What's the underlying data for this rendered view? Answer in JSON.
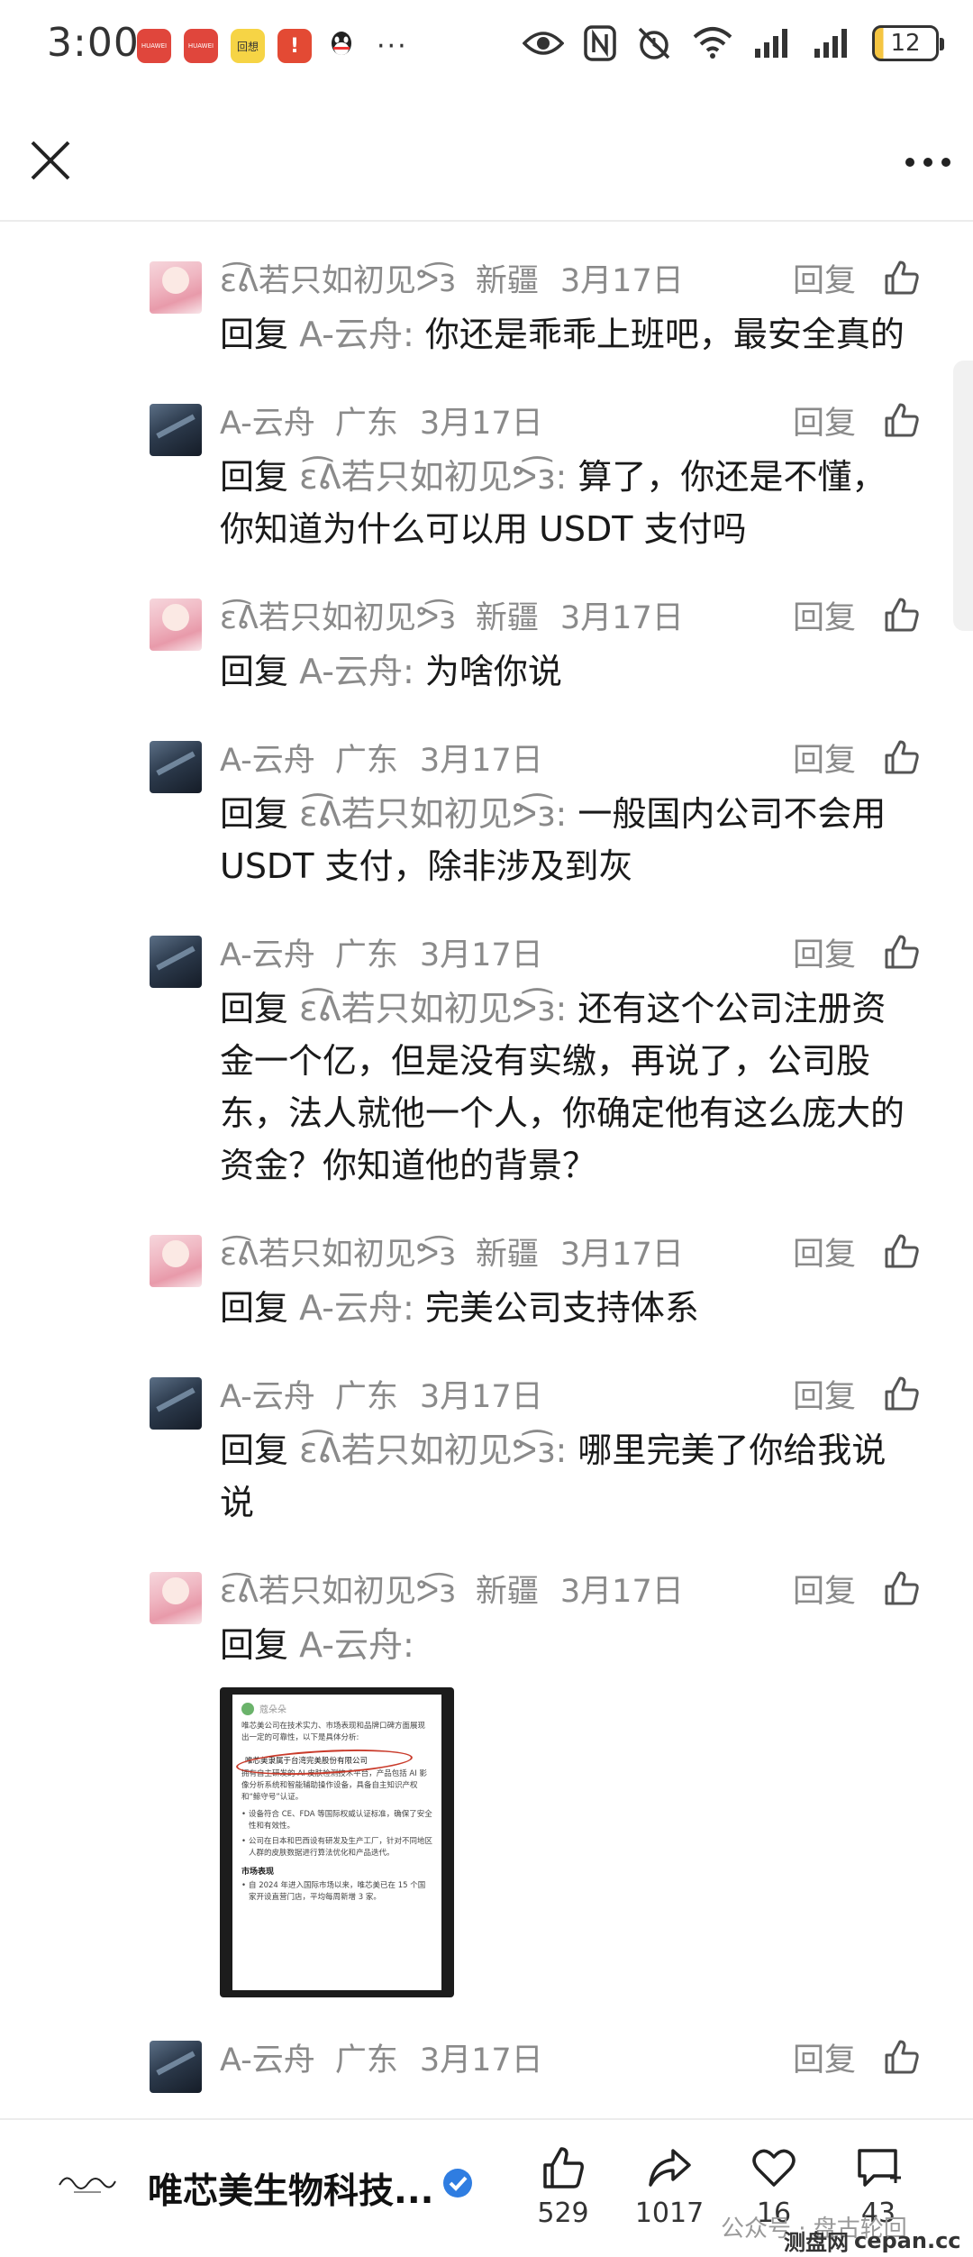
{
  "status_bar": {
    "time": "3:00",
    "battery": "12",
    "apps": [
      {
        "name": "huawei-app-icon",
        "color": "#e0463c",
        "label": "HUAWEI"
      },
      {
        "name": "huawei-app-icon",
        "color": "#e0463c",
        "label": "HUAWEI"
      },
      {
        "name": "yellow-app-icon",
        "color": "#f6d445",
        "label": "回想"
      },
      {
        "name": "red-app-icon",
        "color": "#e34a34",
        "label": "!"
      },
      {
        "name": "qq-icon",
        "color": "#ffffff",
        "label": ""
      }
    ],
    "more": "···"
  },
  "header": {
    "close": "close-icon",
    "more": "more-icon"
  },
  "reply_label": "回复",
  "comments": [
    {
      "avatar": "pink",
      "name": "ε͡ᕕ若只如初见ᕗ͡з",
      "location": "新疆",
      "date": "3月17日",
      "prefix": "回复",
      "target": "A-云舟:",
      "text": " 你还是乖乖上班吧，最安全真的"
    },
    {
      "avatar": "dark",
      "name": "A-云舟",
      "location": "广东",
      "date": "3月17日",
      "prefix": "回复",
      "target": "ε͡ᕕ若只如初见ᕗ͡з:",
      "text": " 算了，你还是不懂，你知道为什么可以用 USDT 支付吗"
    },
    {
      "avatar": "pink",
      "name": "ε͡ᕕ若只如初见ᕗ͡з",
      "location": "新疆",
      "date": "3月17日",
      "prefix": "回复",
      "target": "A-云舟:",
      "text": " 为啥你说"
    },
    {
      "avatar": "dark",
      "name": "A-云舟",
      "location": "广东",
      "date": "3月17日",
      "prefix": "回复",
      "target": "ε͡ᕕ若只如初见ᕗ͡з:",
      "text": " 一般国内公司不会用 USDT 支付，除非涉及到灰"
    },
    {
      "avatar": "dark",
      "name": "A-云舟",
      "location": "广东",
      "date": "3月17日",
      "prefix": "回复",
      "target": "ε͡ᕕ若只如初见ᕗ͡з:",
      "text": " 还有这个公司注册资金一个亿，但是没有实缴，再说了，公司股东，法人就他一个人，你确定他有这么庞大的资金？你知道他的背景？"
    },
    {
      "avatar": "pink",
      "name": "ε͡ᕕ若只如初见ᕗ͡з",
      "location": "新疆",
      "date": "3月17日",
      "prefix": "回复",
      "target": "A-云舟:",
      "text": " 完美公司支持体系"
    },
    {
      "avatar": "dark",
      "name": "A-云舟",
      "location": "广东",
      "date": "3月17日",
      "prefix": "回复",
      "target": "ε͡ᕕ若只如初见ᕗ͡з:",
      "text": " 哪里完美了你给我说说"
    },
    {
      "avatar": "pink",
      "name": "ε͡ᕕ若只如初见ᕗ͡з",
      "location": "新疆",
      "date": "3月17日",
      "prefix": "回复",
      "target": "A-云舟:",
      "text": "",
      "embed": {
        "source": "蔻朵朵",
        "intro": "唯芯美公司在技术实力、市场表现和品牌口碑方面展现出一定的可靠性，以下是具体分析:",
        "highlight": "唯芯美隶属于台湾完美股份有限公司",
        "p2": "拥有自主研发的 AI 皮肤检测技术平台，产品包括 AI 影像分析系统和智能辅助操作设备，具备自主知识产权和“鲸守号”认证。",
        "li1": "设备符合 CE、FDA 等国际权威认证标准，确保了安全性和有效性。",
        "li2": "公司在日本和巴西设有研发及生产工厂，针对不同地区人群的皮肤数据进行算法优化和产品迭代。",
        "h": "市场表现",
        "li3": "自 2024 年进入国际市场以来，唯芯美已在 15 个国家开设直营门店，平均每周新增 3 家。"
      }
    },
    {
      "avatar": "dark",
      "name": "A-云舟",
      "location": "广东",
      "date": "3月17日",
      "prefix": "",
      "target": "",
      "text": ""
    }
  ],
  "bottom": {
    "brand_name": "唯芯美生物科技...",
    "like_count": "529",
    "share_count": "1017",
    "fav_count": "16",
    "comment_count": "43",
    "watermark": "公众号 · 盘古轮回",
    "wm_site": "cepan.cc",
    "wm_site_cn": "测盘网"
  }
}
